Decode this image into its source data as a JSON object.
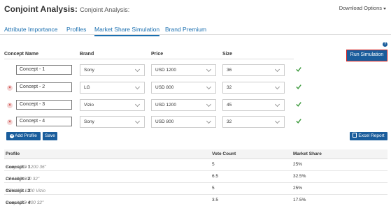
{
  "header": {
    "title": "Conjoint Analysis:",
    "subtitle": "Conjoint Analysis:",
    "download_label": "Download Options"
  },
  "tabs": [
    {
      "label": "Attribute Importance"
    },
    {
      "label": "Profiles"
    },
    {
      "label": "Market Share Simulation",
      "active": true
    },
    {
      "label": "Brand Premium"
    }
  ],
  "concept_table": {
    "columns": {
      "name": "Concept Name",
      "brand": "Brand",
      "price": "Price",
      "size": "Size"
    },
    "rows": [
      {
        "name": "Concept - 1",
        "brand": "Sony",
        "price": "USD 1200",
        "size": "36",
        "removable": false
      },
      {
        "name": "Concept - 2",
        "brand": "LG",
        "price": "USD 800",
        "size": "32",
        "removable": true
      },
      {
        "name": "Concept - 3",
        "brand": "Vizio",
        "price": "USD 1200",
        "size": "45",
        "removable": true
      },
      {
        "name": "Concept - 4",
        "brand": "Sony",
        "price": "USD 800",
        "size": "32",
        "removable": true
      }
    ]
  },
  "buttons": {
    "run_simulation": "Run Simulation",
    "add_profile": "Add Profile",
    "save": "Save",
    "excel_report": "Excel Report"
  },
  "results": {
    "columns": {
      "profile": "Profile",
      "votes": "Vote Count",
      "share": "Market Share"
    },
    "rows": [
      {
        "name": "Concept - 1",
        "desc": "Sony USD 1200 36\"",
        "votes": "5",
        "share": "25%"
      },
      {
        "name": "Concept - 2",
        "desc": "LG USD 800 32\"",
        "votes": "6.5",
        "share": "32.5%"
      },
      {
        "name": "Concept - 3",
        "desc": "45\" USD 1200 Vizio",
        "votes": "5",
        "share": "25%"
      },
      {
        "name": "Concept - 4",
        "desc": "Sony USD 800 32\"",
        "votes": "3.5",
        "share": "17.5%"
      }
    ]
  },
  "colors": {
    "accent": "#1a5d9c",
    "link": "#1a6fb0",
    "check": "#3c9a3c",
    "remove": "#c9302c",
    "highlight_outline": "#d42020"
  },
  "icons": {
    "download": "chevron-down-icon",
    "help": "question-icon",
    "remove": "close-circle-icon",
    "valid": "check-icon",
    "add": "plus-circle-icon",
    "excel": "file-icon",
    "select": "chevron-down-icon"
  }
}
